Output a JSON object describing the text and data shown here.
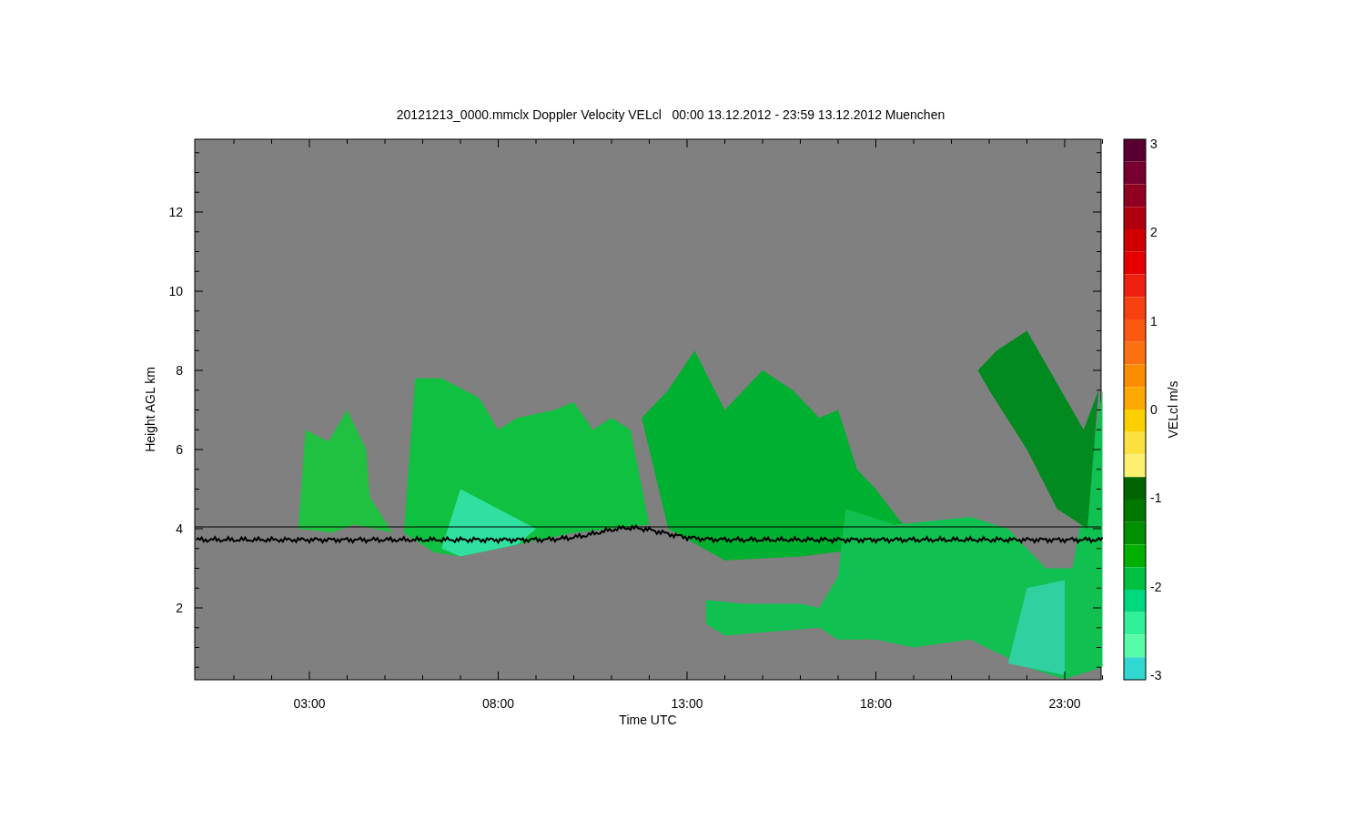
{
  "plot": {
    "title": "20121213_0000.mmclx Doppler Velocity VELcl   00:00 13.12.2012 - 23:59 13.12.2012 Muenchen",
    "x_axis": {
      "label": "Time UTC",
      "ticks": [
        "03:00",
        "08:00",
        "13:00",
        "18:00",
        "23:00"
      ]
    },
    "y_axis": {
      "label": "Height AGL km",
      "ticks": [
        "12",
        "10",
        "8",
        "6",
        "4",
        "2"
      ]
    },
    "colorbar": {
      "label": "VELcl m/s",
      "ticks": [
        "3",
        "2",
        "1",
        "0",
        "-1",
        "-2",
        "-3"
      ]
    }
  }
}
